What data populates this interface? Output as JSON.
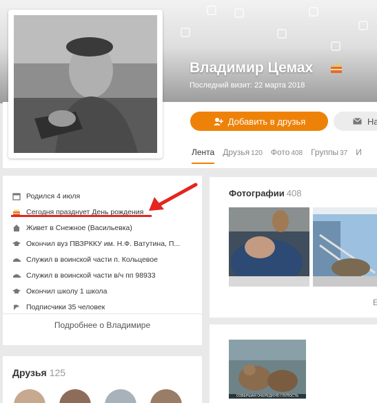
{
  "profile": {
    "name": "Владимир Цемах",
    "last_visit": "Последний визит: 22 марта 2018"
  },
  "actions": {
    "add_friend": "Добавить в друзья",
    "write": "На"
  },
  "tabs": [
    {
      "label": "Лента",
      "count": ""
    },
    {
      "label": "Друзья",
      "count": "120"
    },
    {
      "label": "Фото",
      "count": "408"
    },
    {
      "label": "Группы",
      "count": "37"
    },
    {
      "label": "И",
      "count": ""
    }
  ],
  "info": {
    "items": [
      {
        "icon": "calendar-icon",
        "text": "Родился 4 июля"
      },
      {
        "icon": "cake-icon",
        "text": "Сегодня празднует День рождения"
      },
      {
        "icon": "home-icon",
        "text": "Живет в Снежное (Васильевка)"
      },
      {
        "icon": "graduation-cap-icon",
        "text": "Окончил вуз ПВЗРККУ им. Н.Ф. Ватутина, П..."
      },
      {
        "icon": "military-cap-icon",
        "text": "Служил в воинской части п. Кольцевое"
      },
      {
        "icon": "military-cap-icon",
        "text": "Служил в воинской части в/ч пп 98933"
      },
      {
        "icon": "graduation-cap-icon",
        "text": "Окончил школу 1 школа"
      },
      {
        "icon": "subscribers-icon",
        "text": "Подписчики 35 человек"
      }
    ],
    "more_link": "Подробнее о Владимире"
  },
  "friends": {
    "title": "Друзья",
    "count": "125"
  },
  "photos": {
    "title": "Фотографии",
    "count": "408",
    "more": "Е"
  },
  "post": {
    "caption": "СОВЕРШАЯ ОЧЕРЕДНУЮ ГЛУПОСТЬ"
  },
  "colors": {
    "accent": "#ee8208",
    "highlight_red": "#e3261f",
    "background": "#e9e9e9"
  }
}
